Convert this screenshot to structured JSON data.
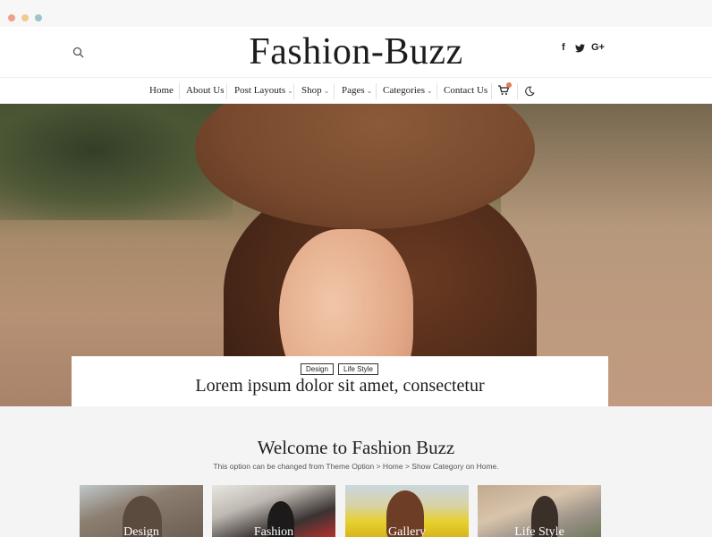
{
  "header": {
    "site_title": "Fashion-Buzz",
    "search_icon": "search-icon",
    "social": [
      {
        "icon": "facebook-icon",
        "glyph": "f"
      },
      {
        "icon": "twitter-icon",
        "glyph": "🐦"
      },
      {
        "icon": "google-plus-icon",
        "glyph": "G+"
      }
    ]
  },
  "nav": {
    "items": [
      {
        "label": "Home",
        "has_dropdown": false
      },
      {
        "label": "About Us",
        "has_dropdown": false
      },
      {
        "label": "Post Layouts",
        "has_dropdown": true
      },
      {
        "label": "Shop",
        "has_dropdown": true
      },
      {
        "label": "Pages",
        "has_dropdown": true
      },
      {
        "label": "Categories",
        "has_dropdown": true
      },
      {
        "label": "Contact Us",
        "has_dropdown": false
      }
    ],
    "caret": "⌄",
    "cart_icon": "cart-icon",
    "dark_mode_icon": "moon-icon"
  },
  "hero": {
    "tags": [
      "Design",
      "Life Style"
    ],
    "title": "Lorem ipsum dolor sit amet, consectetur"
  },
  "welcome": {
    "title": "Welcome to Fashion Buzz",
    "subtitle": "This option can be changed from Theme Option > Home > Show Category on Home."
  },
  "categories": [
    {
      "label": "Design"
    },
    {
      "label": "Fashion"
    },
    {
      "label": "Gallery"
    },
    {
      "label": "Life Style"
    }
  ],
  "colors": {
    "accent": "#e57b5e",
    "background": "#f4f4f4"
  }
}
